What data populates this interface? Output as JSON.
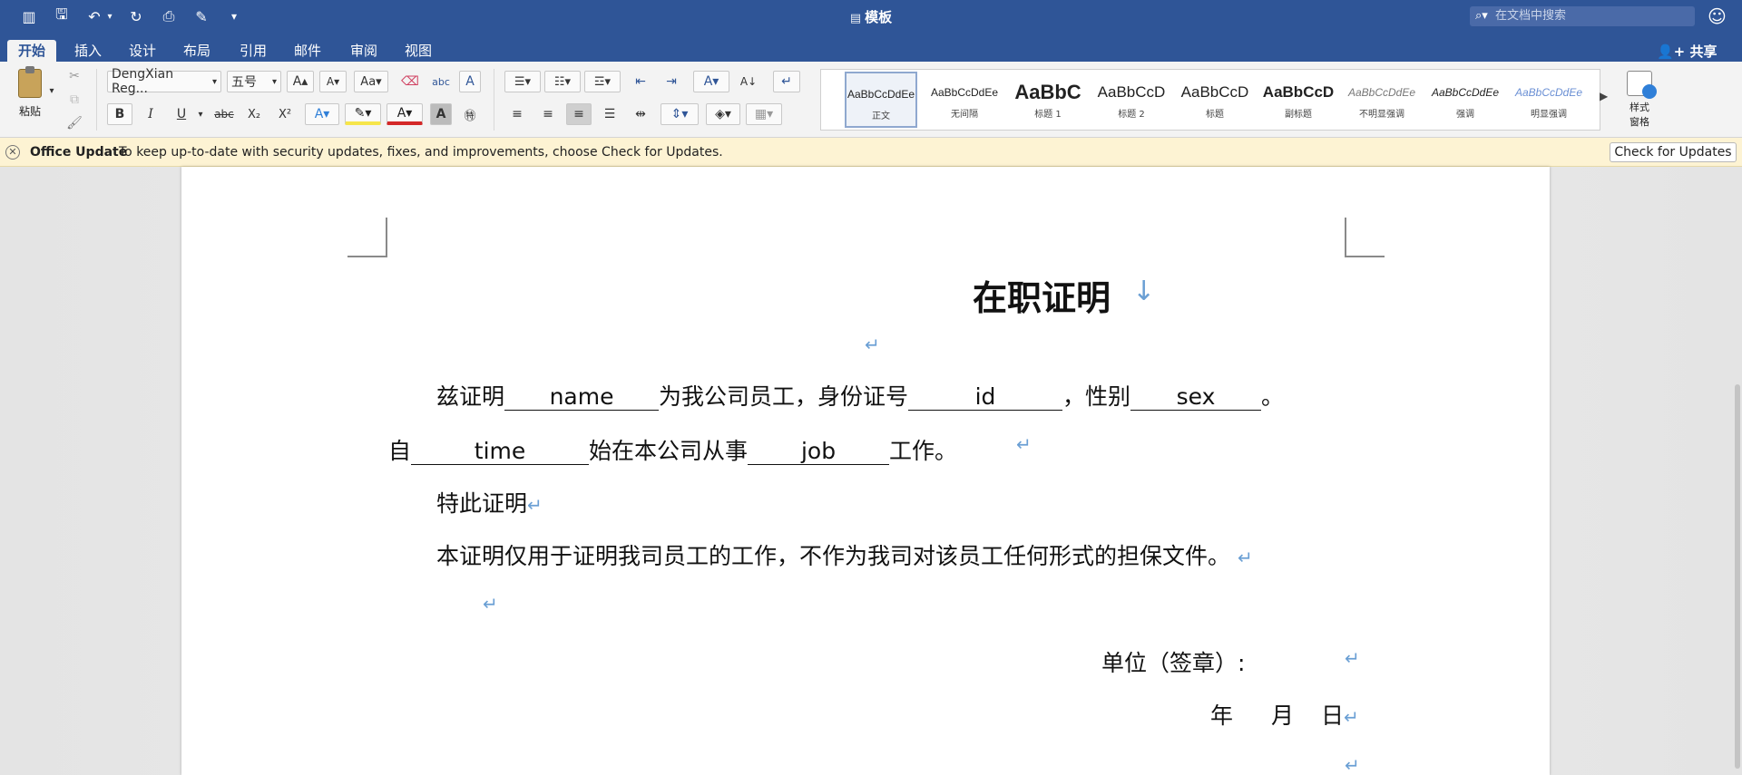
{
  "titlebar": {
    "doc_title": "模板",
    "search_placeholder": "在文档中搜索"
  },
  "tabs": [
    {
      "label": "开始",
      "active": true
    },
    {
      "label": "插入"
    },
    {
      "label": "设计"
    },
    {
      "label": "布局"
    },
    {
      "label": "引用"
    },
    {
      "label": "邮件"
    },
    {
      "label": "审阅"
    },
    {
      "label": "视图"
    }
  ],
  "share_label": "共享",
  "ribbon": {
    "paste_label": "粘贴",
    "font_name": "DengXian Reg...",
    "font_size": "五号",
    "styles": [
      {
        "sample": "AaBbCcDdEe",
        "name": "正文",
        "selected": true
      },
      {
        "sample": "AaBbCcDdEe",
        "name": "无间隔"
      },
      {
        "sample": "AaBbC",
        "name": "标题 1"
      },
      {
        "sample": "AaBbCcD",
        "name": "标题 2"
      },
      {
        "sample": "AaBbCcD",
        "name": "标题"
      },
      {
        "sample": "AaBbCcD",
        "name": "副标题"
      },
      {
        "sample": "AaBbCcDdEe",
        "name": "不明显强调"
      },
      {
        "sample": "AaBbCcDdEe",
        "name": "强调"
      },
      {
        "sample": "AaBbCcDdEe",
        "name": "明显强调"
      }
    ],
    "styles_pane_label": "样式\n窗格"
  },
  "update_bar": {
    "title": "Office Update",
    "message": "To keep up-to-date with security updates, fixes, and improvements, choose Check for Updates.",
    "button": "Check for Updates"
  },
  "document": {
    "heading": "在职证明",
    "line1_prefix": "兹证明",
    "line1_name": "name",
    "line1_mid": "为我公司员工，身份证号",
    "line1_id": "id",
    "line1_mid2": "，性别",
    "line1_sex": "sex",
    "line1_end": "。",
    "line2_prefix": "自",
    "line2_time": "time",
    "line2_mid": "始在本公司从事",
    "line2_job": "job",
    "line2_end": "工作。",
    "line3": "特此证明",
    "line4": "本证明仅用于证明我司员工的工作，不作为我司对该员工任何形式的担保文件。",
    "sign_unit": "单位（签章）:",
    "sign_year": "年",
    "sign_month": "月",
    "sign_day": "日",
    "para_mark": "↵"
  },
  "colors": {
    "accent": "#2f5597",
    "update_bar": "#fdf3d3",
    "para_mark": "#6a9fd4"
  }
}
